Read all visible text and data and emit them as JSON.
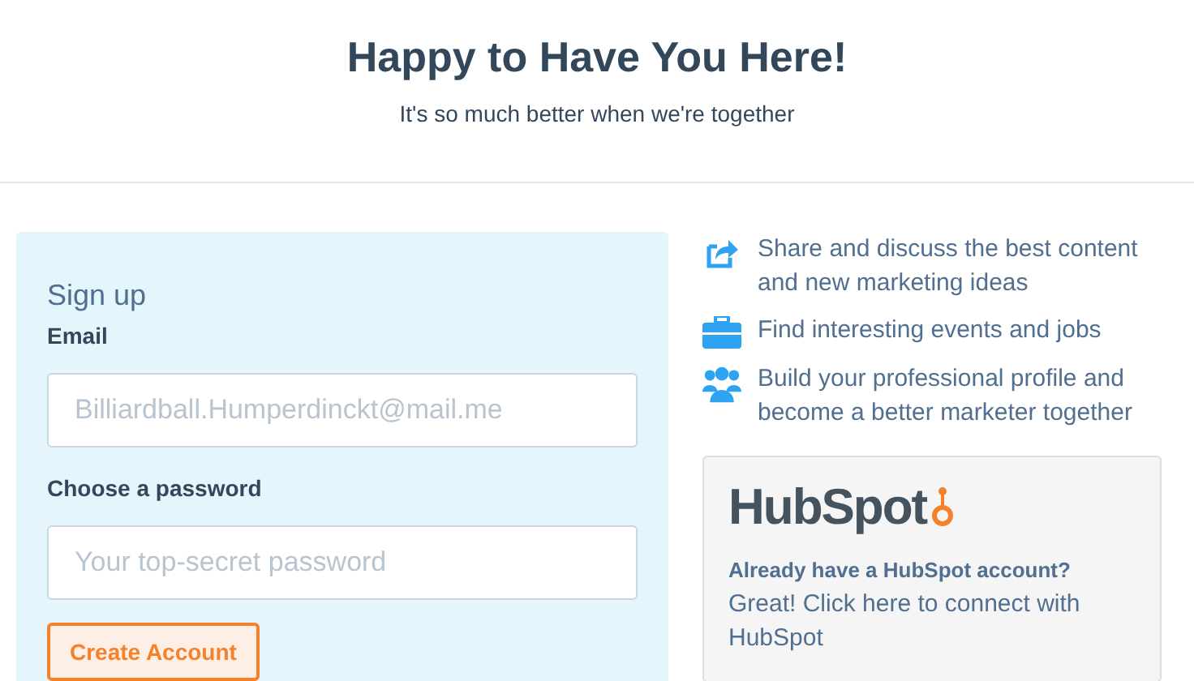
{
  "header": {
    "title": "Happy to Have You Here!",
    "subtitle": "It's so much better when we're together"
  },
  "signup": {
    "heading": "Sign up",
    "fields": [
      {
        "label": "Email",
        "placeholder": "Billiardball.Humperdinckt@mail.me"
      },
      {
        "label": "Choose a password",
        "placeholder": "Your top-secret password"
      }
    ],
    "button": "Create Account"
  },
  "features": [
    {
      "kind": "share",
      "text": "Share and discuss the best content and new marketing ideas"
    },
    {
      "kind": "briefcase",
      "text": "Find interesting events and jobs"
    },
    {
      "kind": "people",
      "text": "Build your professional profile and become a better marketer together"
    }
  ],
  "hubspot_card": {
    "logo": "HubSpot",
    "question": "Already have a HubSpot account?",
    "link": "Great! Click here to connect with HubSpot"
  }
}
